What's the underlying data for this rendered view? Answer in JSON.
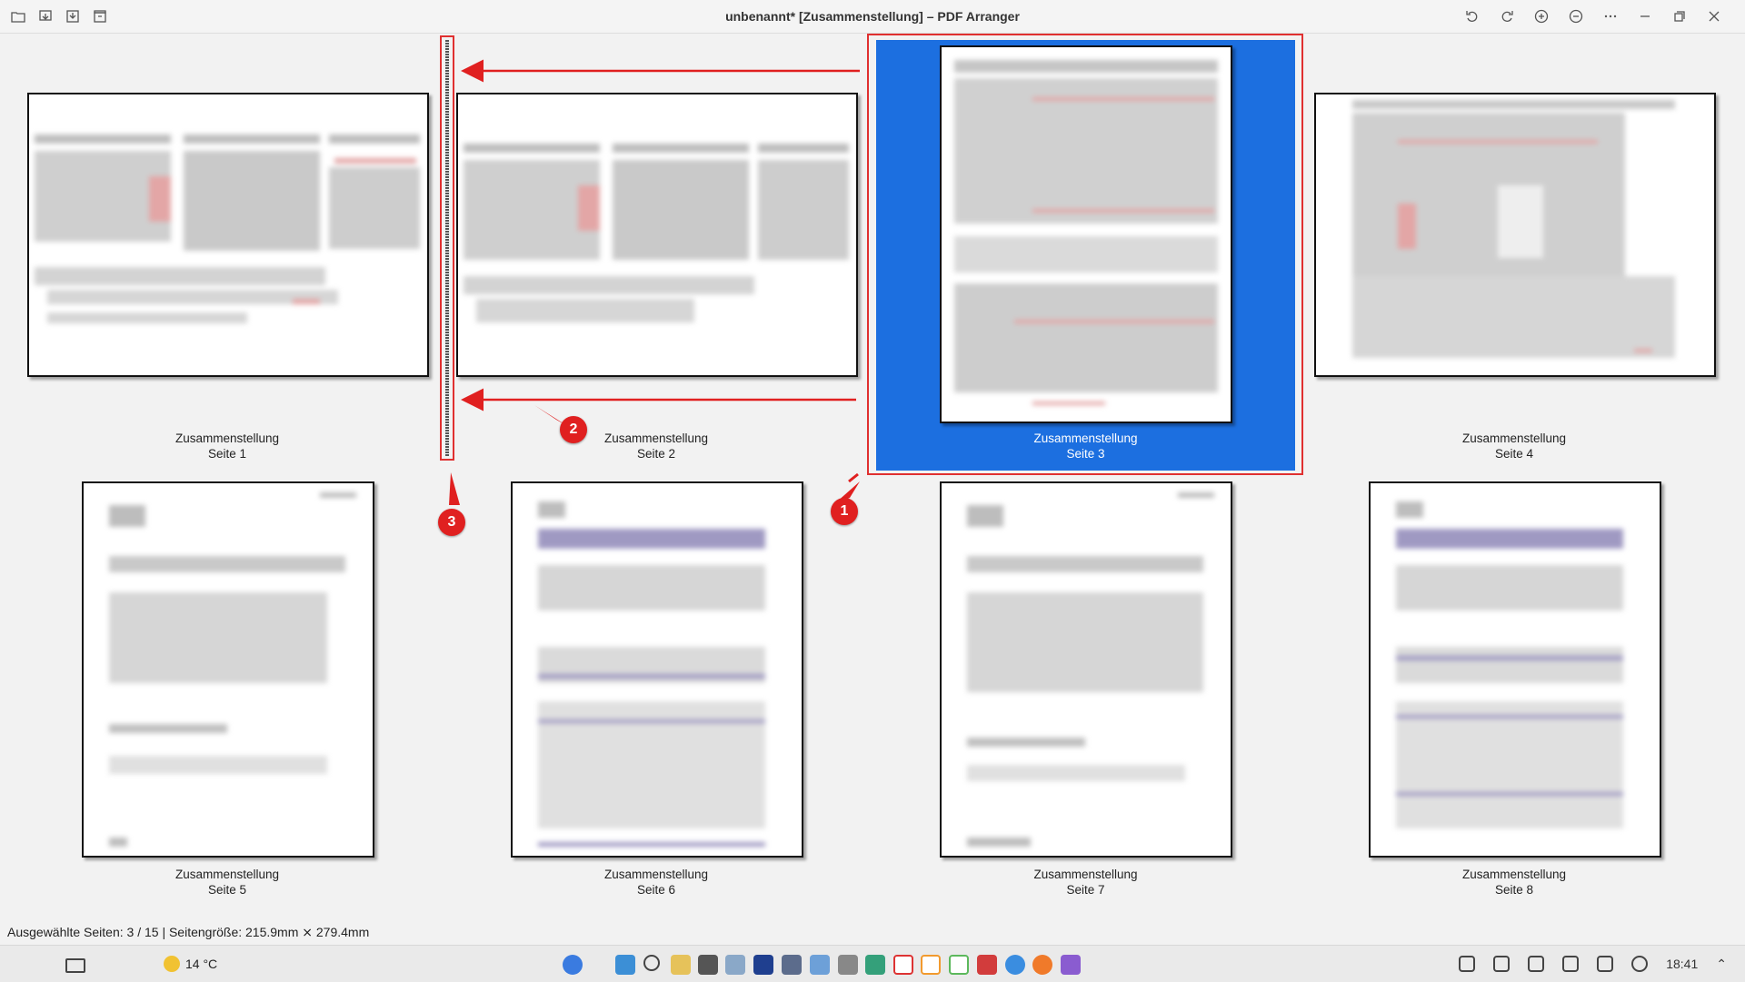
{
  "window": {
    "title": "unbenannt* [Zusammenstellung] – PDF Arranger"
  },
  "toolbar_left": [
    "open-icon",
    "import-icon",
    "save-icon",
    "save-as-icon"
  ],
  "toolbar_right": [
    "rotate-left-icon",
    "rotate-right-icon",
    "zoom-in-icon",
    "zoom-out-icon",
    "menu-icon",
    "minimize-icon",
    "maximize-icon",
    "close-icon"
  ],
  "pages": [
    {
      "name": "Zusammenstellung",
      "page": "Seite 1",
      "orientation": "landscape",
      "selected": false
    },
    {
      "name": "Zusammenstellung",
      "page": "Seite 2",
      "orientation": "landscape",
      "selected": false
    },
    {
      "name": "Zusammenstellung",
      "page": "Seite 3",
      "orientation": "portrait",
      "selected": true
    },
    {
      "name": "Zusammenstellung",
      "page": "Seite 4",
      "orientation": "landscape",
      "selected": false
    },
    {
      "name": "Zusammenstellung",
      "page": "Seite 5",
      "orientation": "portrait",
      "selected": false
    },
    {
      "name": "Zusammenstellung",
      "page": "Seite 6",
      "orientation": "portrait",
      "selected": false
    },
    {
      "name": "Zusammenstellung",
      "page": "Seite 7",
      "orientation": "portrait",
      "selected": false
    },
    {
      "name": "Zusammenstellung",
      "page": "Seite 8",
      "orientation": "portrait",
      "selected": false
    }
  ],
  "annotations": [
    "1",
    "2",
    "3"
  ],
  "annotation_color": "#e02020",
  "selection_color": "#1c6fe0",
  "status": "Ausgewählte Seiten: 3 / 15 | Seitengröße: 215.9mm ⨯ 279.4mm",
  "taskbar": {
    "weather": "14 °C",
    "clock": "18:41"
  }
}
